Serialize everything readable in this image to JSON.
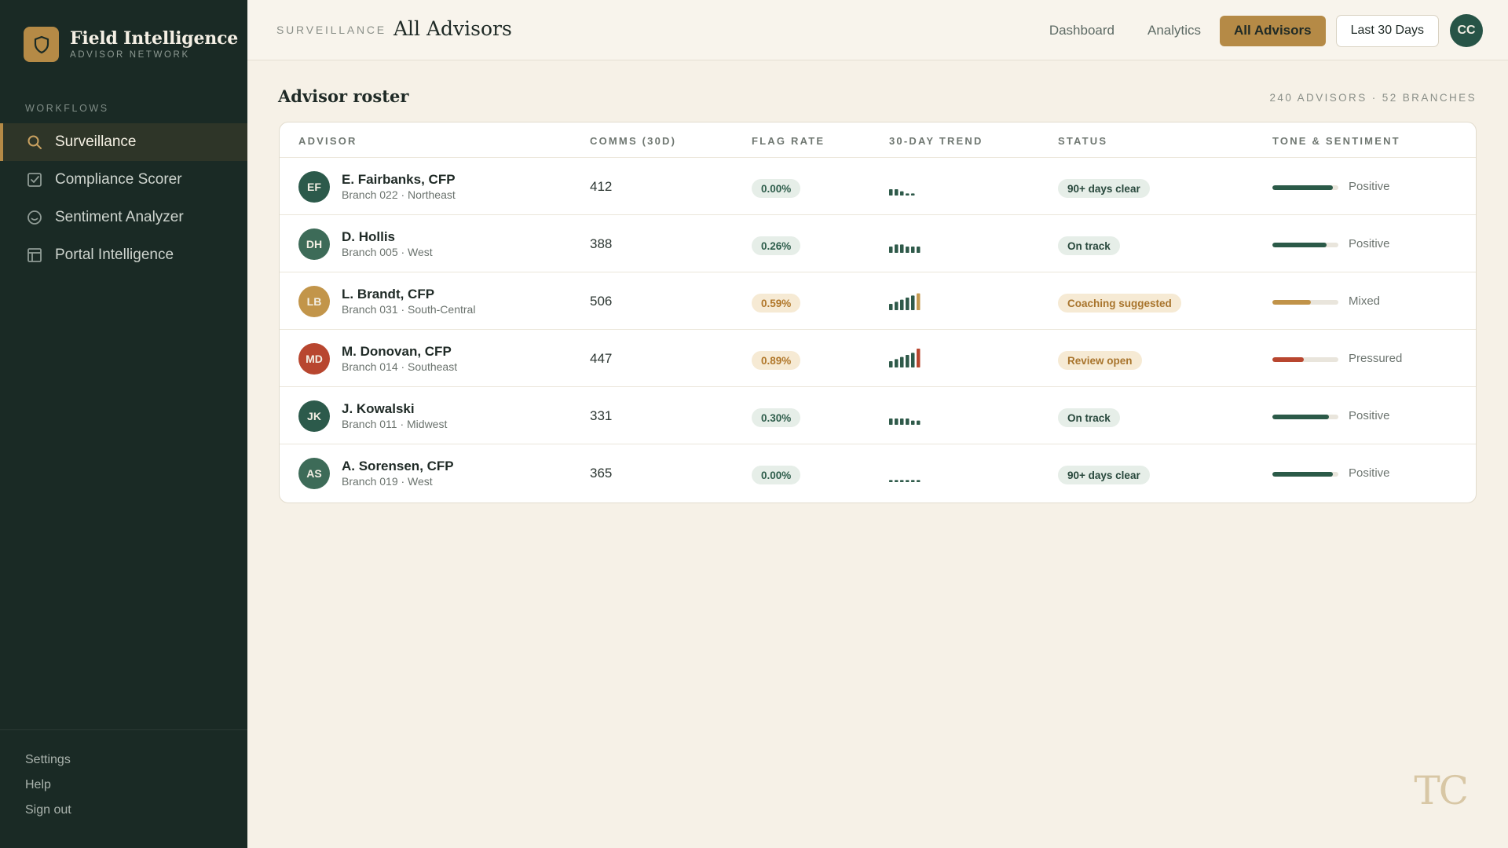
{
  "brand": {
    "title": "Field Intelligence",
    "subtitle": "ADVISOR NETWORK",
    "logo_icon": "shield-icon",
    "accent": "#b58a46"
  },
  "sidebar": {
    "section_label": "WORKFLOWS",
    "items": [
      {
        "label": "Surveillance",
        "icon": "search-icon",
        "active": true
      },
      {
        "label": "Compliance Scorer",
        "icon": "check-square-icon",
        "active": false
      },
      {
        "label": "Sentiment Analyzer",
        "icon": "smile-icon",
        "active": false
      },
      {
        "label": "Portal Intelligence",
        "icon": "layout-icon",
        "active": false
      }
    ],
    "footer": [
      "Settings",
      "Help",
      "Sign out"
    ]
  },
  "header": {
    "breadcrumb": "SURVEILLANCE",
    "title": "All Advisors",
    "nav": [
      "Dashboard",
      "Analytics"
    ],
    "active_button": "All Advisors",
    "range_button": "Last 30 Days",
    "user_initials": "CC"
  },
  "roster": {
    "title": "Advisor roster",
    "meta": "240 ADVISORS · 52 BRANCHES",
    "columns": [
      "ADVISOR",
      "COMMS (30D)",
      "FLAG RATE",
      "30-DAY TREND",
      "STATUS",
      "TONE & SENTIMENT"
    ],
    "rows": [
      {
        "initials": "EF",
        "avatar_color": "#2c5a4b",
        "name": "E. Fairbanks, CFP",
        "branch": "Branch 022 · Northeast",
        "comms": "412",
        "flag_rate": "0.00%",
        "flag_tone": "green",
        "trend": [
          3,
          3,
          2,
          1,
          1
        ],
        "trend_highlight": false,
        "status": "90+ days clear",
        "status_tone": "green",
        "sentiment": "Positive",
        "sentiment_level": 0.92,
        "sentiment_color": "#2b5a48"
      },
      {
        "initials": "DH",
        "avatar_color": "#3d6b58",
        "name": "D. Hollis",
        "branch": "Branch 005 · West",
        "comms": "388",
        "flag_rate": "0.26%",
        "flag_tone": "green",
        "trend": [
          3,
          4,
          4,
          3,
          3,
          3
        ],
        "trend_highlight": false,
        "status": "On track",
        "status_tone": "green",
        "sentiment": "Positive",
        "sentiment_level": 0.82,
        "sentiment_color": "#2b5a48"
      },
      {
        "initials": "LB",
        "avatar_color": "#c2954a",
        "name": "L. Brandt, CFP",
        "branch": "Branch 031 · South-Central",
        "comms": "506",
        "flag_rate": "0.59%",
        "flag_tone": "amber",
        "trend": [
          3,
          4,
          5,
          6,
          7,
          8
        ],
        "trend_highlight": true,
        "trend_highlight_color": "#c49a52",
        "status": "Coaching suggested",
        "status_tone": "amber",
        "sentiment": "Mixed",
        "sentiment_level": 0.58,
        "sentiment_color": "#c19349"
      },
      {
        "initials": "MD",
        "avatar_color": "#b8462f",
        "name": "M. Donovan, CFP",
        "branch": "Branch 014 · Southeast",
        "comms": "447",
        "flag_rate": "0.89%",
        "flag_tone": "amber",
        "trend": [
          3,
          4,
          5,
          6,
          7,
          9
        ],
        "trend_highlight": true,
        "trend_highlight_color": "#b8462f",
        "status": "Review open",
        "status_tone": "amber",
        "sentiment": "Pressured",
        "sentiment_level": 0.48,
        "sentiment_color": "#b8462f"
      },
      {
        "initials": "JK",
        "avatar_color": "#2c5a4b",
        "name": "J. Kowalski",
        "branch": "Branch 011 · Midwest",
        "comms": "331",
        "flag_rate": "0.30%",
        "flag_tone": "green",
        "trend": [
          3,
          3,
          3,
          3,
          2,
          2
        ],
        "trend_highlight": false,
        "status": "On track",
        "status_tone": "green",
        "sentiment": "Positive",
        "sentiment_level": 0.86,
        "sentiment_color": "#2b5a48"
      },
      {
        "initials": "AS",
        "avatar_color": "#3d6b58",
        "name": "A. Sorensen, CFP",
        "branch": "Branch 019 · West",
        "comms": "365",
        "flag_rate": "0.00%",
        "flag_tone": "green",
        "trend": [
          1,
          1,
          1,
          1,
          1,
          1
        ],
        "trend_highlight": false,
        "status": "90+ days clear",
        "status_tone": "green",
        "sentiment": "Positive",
        "sentiment_level": 0.92,
        "sentiment_color": "#2b5a48"
      }
    ]
  },
  "watermark": "TC"
}
